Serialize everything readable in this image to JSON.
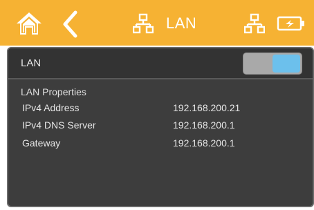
{
  "header": {
    "title": "LAN",
    "icons": {
      "home": "home-icon",
      "back": "chevron-left-icon",
      "title": "network-icon",
      "status": "network-status-icon",
      "battery": "battery-charging-icon"
    },
    "accent_color": "#f6b233"
  },
  "lan": {
    "label": "LAN",
    "toggle_on": true,
    "toggle_color": "#6cc0ec"
  },
  "properties": {
    "title": "LAN Properties",
    "rows": [
      {
        "name": "IPv4 Address",
        "value": "192.168.200.21"
      },
      {
        "name": "IPv4 DNS Server",
        "value": "192.168.200.1"
      },
      {
        "name": "Gateway",
        "value": "192.168.200.1"
      }
    ]
  }
}
